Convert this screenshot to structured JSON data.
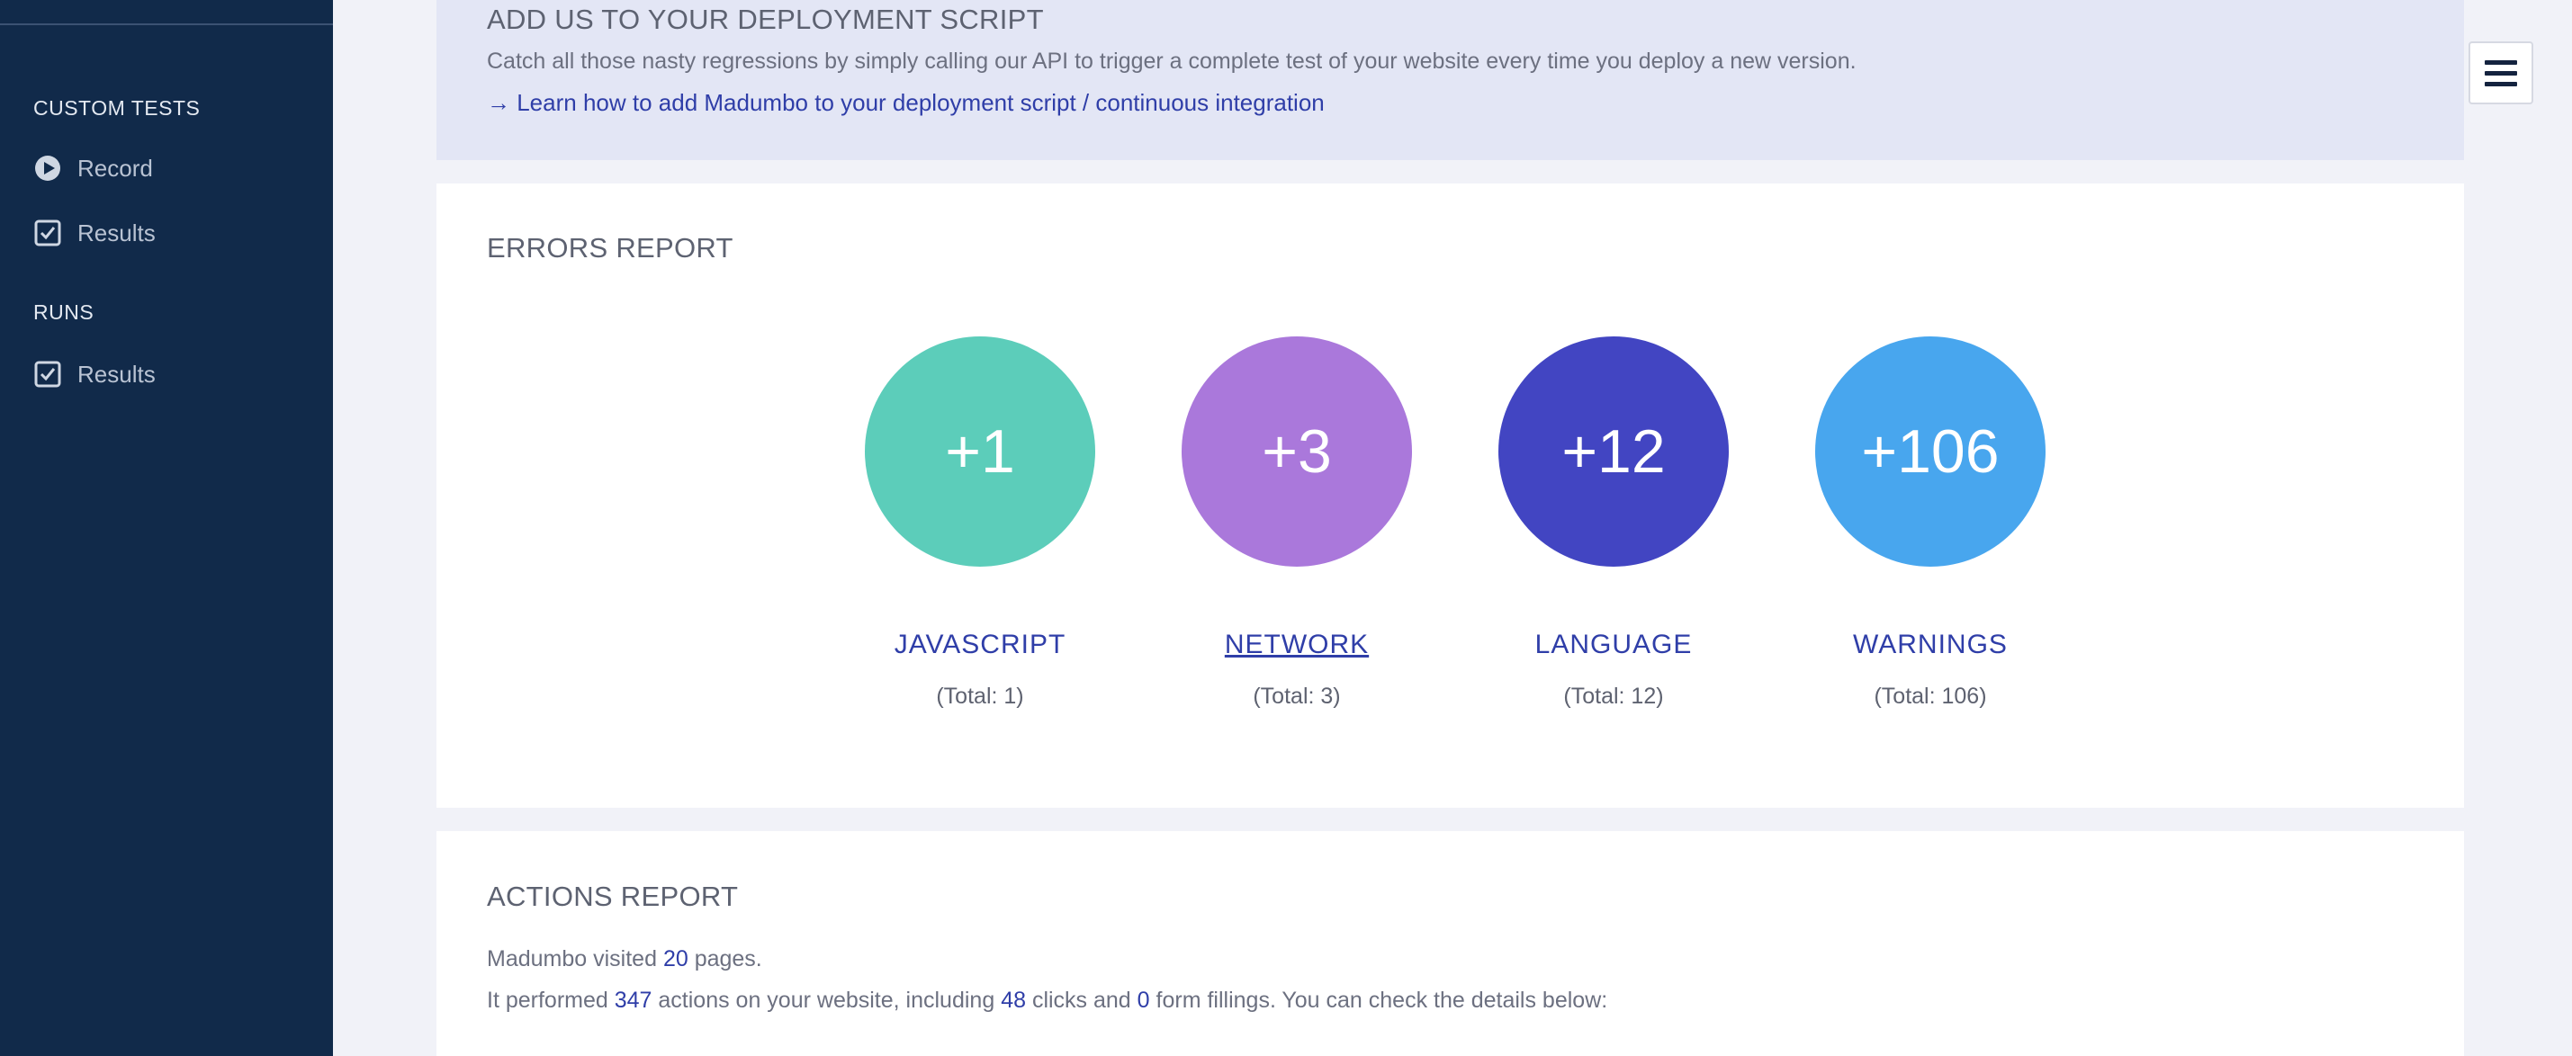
{
  "sidebar": {
    "sections": [
      {
        "title": "CUSTOM TESTS",
        "items": [
          {
            "label": "Record",
            "icon": "play-circle-icon"
          },
          {
            "label": "Results",
            "icon": "checkbox-icon"
          }
        ]
      },
      {
        "title": "RUNS",
        "items": [
          {
            "label": "Results",
            "icon": "checkbox-icon"
          }
        ]
      }
    ]
  },
  "deploy": {
    "title": "ADD US TO YOUR DEPLOYMENT SCRIPT",
    "description": "Catch all those nasty regressions by simply calling our API to trigger a complete test of your website every time you deploy a new version.",
    "link": "→ Learn how to add Madumbo to your deployment script / continuous integration"
  },
  "errors": {
    "title": "ERRORS REPORT",
    "metrics": [
      {
        "value": "+1",
        "label": "JAVASCRIPT",
        "total": "(Total: 1)",
        "color": "#5ccdba"
      },
      {
        "value": "+3",
        "label": "NETWORK",
        "total": "(Total: 3)",
        "color": "#aa78db"
      },
      {
        "value": "+12",
        "label": "LANGUAGE",
        "total": "(Total: 12)",
        "color": "#4245c2"
      },
      {
        "value": "+106",
        "label": "WARNINGS",
        "total": "(Total: 106)",
        "color": "#48a6ee"
      }
    ]
  },
  "actions": {
    "title": "ACTIONS REPORT",
    "line1": {
      "pre": "Madumbo visited ",
      "pages": "20",
      "post": " pages."
    },
    "line2": {
      "pre": "It performed ",
      "actions": "347",
      "mid1": " actions on your website, including ",
      "clicks": "48",
      "mid2": " clicks and ",
      "forms": "0",
      "post": " form fillings. You can check the details below:"
    }
  },
  "menu": {
    "icon": "hamburger-menu-icon"
  },
  "colors": {
    "sidebar": "#112a4a",
    "accent": "#2f3ea8",
    "deploy_bg": "#e3e6f5"
  }
}
